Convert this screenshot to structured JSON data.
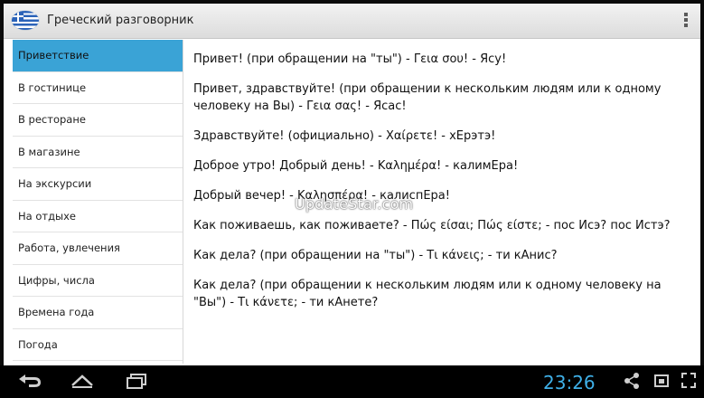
{
  "app": {
    "title": "Греческий разговорник",
    "flag_icon": "greek-flag-icon",
    "menu_icon": "overflow-menu-icon"
  },
  "sidebar": {
    "items": [
      {
        "label": "Приветствие",
        "active": true
      },
      {
        "label": "В гостинице"
      },
      {
        "label": "В ресторане"
      },
      {
        "label": "В магазине"
      },
      {
        "label": "На экскурсии"
      },
      {
        "label": "На отдыхе"
      },
      {
        "label": "Работа, увлечения"
      },
      {
        "label": "Цифры, числа"
      },
      {
        "label": "Времена года"
      },
      {
        "label": "Погода"
      }
    ],
    "active_color": "#3aa3d6"
  },
  "phrases": [
    "Привет! (при обращении на \"ты\") - Γεια σου! - Ясу!",
    "Привет, здравствуйте! (при обращении к нескольким людям или к одному человеку на Вы) - Γεια σας! - Ясас!",
    "Здравствуйте! (официально) - Χαίρετε! - хЕрэтэ!",
    "Доброе утро! Добрый день! - Καλημέρα! - калимЕра!",
    "Добрый вечер! - Καλησπέρα! - калиспЕра!",
    "Как поживаешь, как поживаете? - Πώς είσαι; Πώς είστε; - пос Исэ? пос Истэ?",
    "Как дела? (при обращении на \"ты\") - Τι κάνεις; - ти кАнис?",
    "Как дела? (при обращении к нескольким людям или к одному человеку на \"Вы\") - Τι κάνετε; - ти кАнете?"
  ],
  "watermark": "UpdateStar.com",
  "system_bar": {
    "clock": "23:26",
    "clock_color": "#3fb0e8",
    "icons": [
      "back-icon",
      "home-icon",
      "recent-apps-icon",
      "share-icon",
      "screenshot-icon",
      "fullscreen-icon"
    ]
  }
}
